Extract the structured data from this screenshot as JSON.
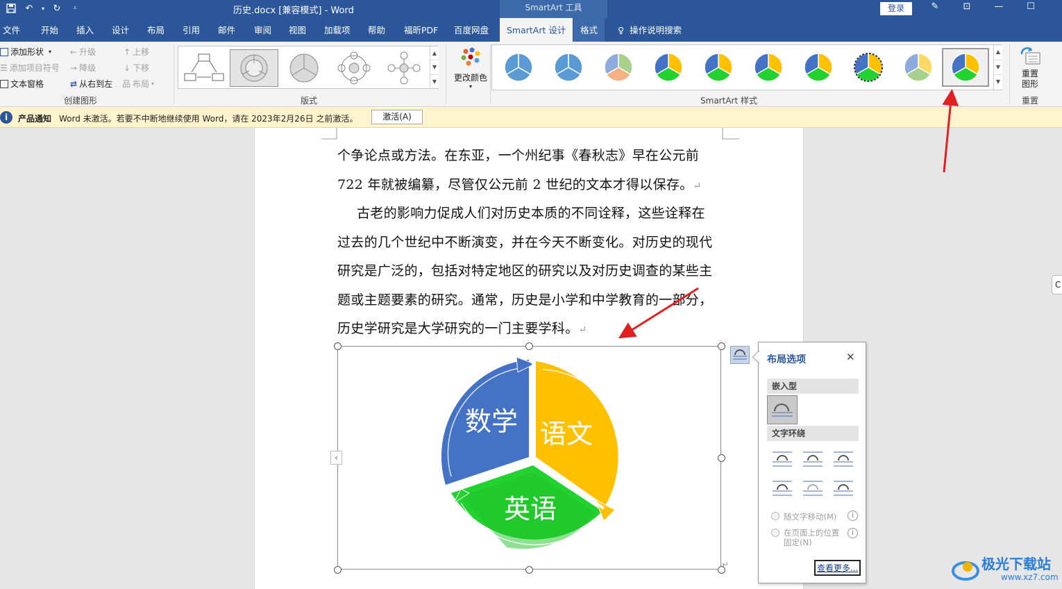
{
  "titlebar": {
    "document_title": "历史.docx [兼容模式]  -  Word",
    "context_tools": "SmartArt 工具",
    "login": "登录"
  },
  "tabs": [
    "文件",
    "开始",
    "插入",
    "设计",
    "布局",
    "引用",
    "邮件",
    "审阅",
    "视图",
    "加载项",
    "帮助",
    "福昕PDF",
    "百度网盘",
    "SmartArt 设计",
    "格式"
  ],
  "tell_me": "操作说明搜索",
  "ribbon": {
    "create_graphic": {
      "label": "创建图形",
      "add_shape": "添加形状",
      "add_bullet": "添加项目符号",
      "text_pane": "文本窗格",
      "promote": "升级",
      "demote": "降级",
      "right_to_left": "从右到左",
      "move_up": "上移",
      "move_down": "下移",
      "layout": "布局"
    },
    "layouts_label": "版式",
    "change_colors": "更改颜色",
    "styles_label": "SmartArt 样式",
    "reset": {
      "button": "重置图形",
      "label": "重置"
    }
  },
  "notification": {
    "title": "产品通知",
    "message": "Word 未激活。若要不中断地继续使用 Word，请在 2023年2月26日 之前激活。",
    "button": "激活(A)"
  },
  "document": {
    "lines": [
      "个争论点或方法。在东亚，一个州纪事《春秋志》早在公元前",
      "722 年就被编纂，尽管仅公元前 2 世纪的文本才得以保存。",
      "古老的影响力促成人们对历史本质的不同诠释，这些诠释在",
      "过去的几个世纪中不断演变，并在今天不断变化。对历史的现代",
      "研究是广泛的，包括对特定地区的研究以及对历史调查的某些主",
      "题或主题要素的研究。通常，历史是小学和中学教育的一部分，",
      "历史学研究是大学研究的一门主要学科。"
    ]
  },
  "smartart": {
    "segments": [
      {
        "label": "数学",
        "color": "#4472c4"
      },
      {
        "label": "语文",
        "color": "#ffc000"
      },
      {
        "label": "英语",
        "color": "#22d22e"
      }
    ]
  },
  "layout_options": {
    "title": "布局选项",
    "inline_section": "嵌入型",
    "wrap_section": "文字环绕",
    "move_with_text": "随文字移动(M)",
    "fix_position": "在页面上的位置\n固定(N)",
    "fix_position_line1": "在页面上的位置",
    "fix_position_line2": "固定(N)",
    "see_more": "查看更多..."
  },
  "watermark": {
    "text": "极光下载站",
    "url": "www.xz7.com"
  },
  "colors": {
    "word_blue": "#2b579a",
    "arrow_red": "#e02020"
  }
}
